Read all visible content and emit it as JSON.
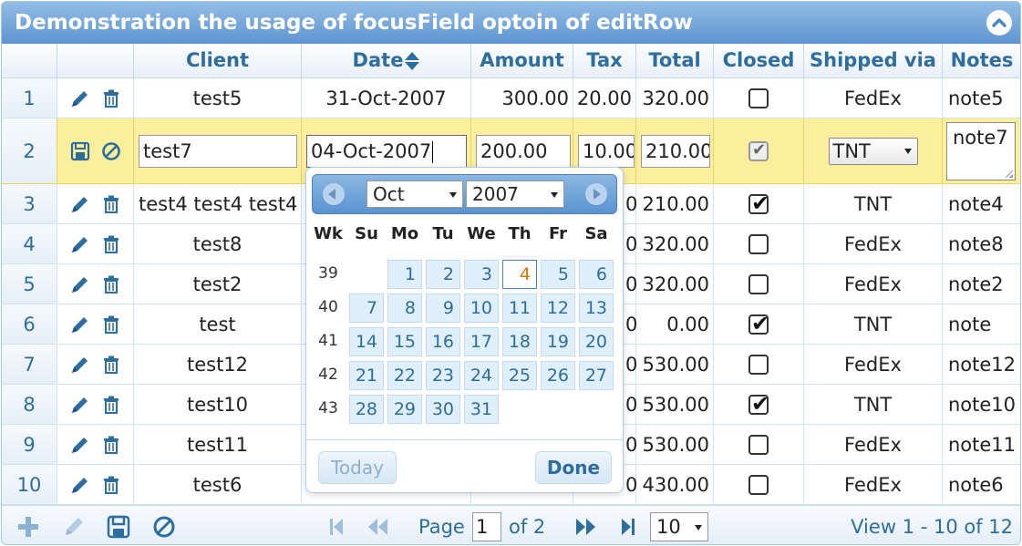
{
  "caption": {
    "title": "Demonstration the usage of focusField optoin of editRow",
    "collapse_icon": "circle-chevron-up-icon"
  },
  "columns": [
    "Client",
    "Date",
    "Amount",
    "Tax",
    "Total",
    "Closed",
    "Shipped via",
    "Notes"
  ],
  "sorted_column": "Date",
  "rows": [
    {
      "rn": "1",
      "client": "test5",
      "date": "31-Oct-2007",
      "amount": "300.00",
      "tax": "20.00",
      "total": "320.00",
      "closed": false,
      "ship": "FedEx",
      "notes": "note5"
    },
    {
      "rn": "2",
      "editing": true,
      "client": "test7",
      "date": "04-Oct-2007",
      "amount": "200.00",
      "tax": "10.00",
      "total": "210.00",
      "closed": true,
      "ship": "TNT",
      "notes": "note7"
    },
    {
      "rn": "3",
      "client": "test4 test4 test4",
      "date": "",
      "amount": "",
      "tax": "",
      "total": "210.00",
      "total_prefix": "0",
      "closed": true,
      "ship": "TNT",
      "notes": "note4"
    },
    {
      "rn": "4",
      "client": "test8",
      "date": "",
      "amount": "",
      "tax": "",
      "total": "320.00",
      "total_prefix": "0",
      "closed": false,
      "ship": "FedEx",
      "notes": "note8"
    },
    {
      "rn": "5",
      "client": "test2",
      "date": "",
      "amount": "",
      "tax": "",
      "total": "320.00",
      "total_prefix": "0",
      "closed": false,
      "ship": "FedEx",
      "notes": "note2"
    },
    {
      "rn": "6",
      "client": "test",
      "date": "",
      "amount": "",
      "tax": "",
      "total": "0.00",
      "total_prefix": "0",
      "closed": true,
      "ship": "TNT",
      "notes": "note"
    },
    {
      "rn": "7",
      "client": "test12",
      "date": "",
      "amount": "",
      "tax": "",
      "total": "530.00",
      "total_prefix": "0",
      "closed": false,
      "ship": "FedEx",
      "notes": "note12"
    },
    {
      "rn": "8",
      "client": "test10",
      "date": "",
      "amount": "",
      "tax": "",
      "total": "530.00",
      "total_prefix": "0",
      "closed": true,
      "ship": "TNT",
      "notes": "note10"
    },
    {
      "rn": "9",
      "client": "test11",
      "date": "",
      "amount": "",
      "tax": "",
      "total": "530.00",
      "total_prefix": "0",
      "closed": false,
      "ship": "FedEx",
      "notes": "note11"
    },
    {
      "rn": "10",
      "client": "test6",
      "date": "",
      "amount": "",
      "tax": "",
      "total": "430.00",
      "total_prefix": "0",
      "closed": false,
      "ship": "FedEx",
      "notes": "note6"
    }
  ],
  "datepicker": {
    "month": "Oct",
    "year": "2007",
    "dow": [
      "Wk",
      "Su",
      "Mo",
      "Tu",
      "We",
      "Th",
      "Fr",
      "Sa"
    ],
    "weeks": [
      {
        "wk": "39",
        "days": [
          "",
          "1",
          "2",
          "3",
          "4",
          "5",
          "6"
        ]
      },
      {
        "wk": "40",
        "days": [
          "7",
          "8",
          "9",
          "10",
          "11",
          "12",
          "13"
        ]
      },
      {
        "wk": "41",
        "days": [
          "14",
          "15",
          "16",
          "17",
          "18",
          "19",
          "20"
        ]
      },
      {
        "wk": "42",
        "days": [
          "21",
          "22",
          "23",
          "24",
          "25",
          "26",
          "27"
        ]
      },
      {
        "wk": "43",
        "days": [
          "28",
          "29",
          "30",
          "31",
          "",
          "",
          ""
        ]
      }
    ],
    "highlighted_day": "4",
    "today_label": "Today",
    "done_label": "Done"
  },
  "pager": {
    "page_label": "Page",
    "page_value": "1",
    "of_label": "of 2",
    "rows_per_page": "10",
    "view_text": "View 1 - 10 of 12",
    "icons": [
      "add-icon",
      "edit-icon",
      "save-icon",
      "cancel-icon",
      "first-page-icon",
      "prev-page-icon",
      "next-page-icon",
      "last-page-icon"
    ]
  },
  "colors": {
    "header_text": "#2e6e9e",
    "edit_row_bg": "#fbef9e",
    "caption_bg": "#5d95d0",
    "today_text": "#e17009"
  }
}
